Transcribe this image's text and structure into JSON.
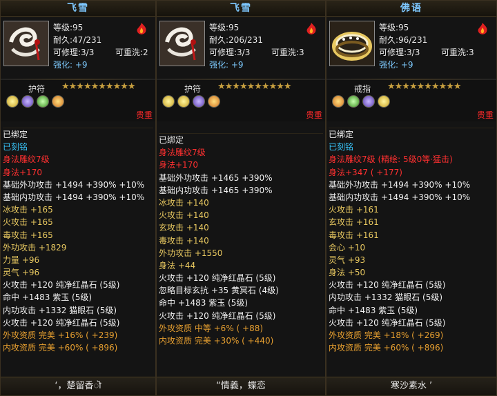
{
  "panels": [
    {
      "title": "飞雪",
      "level": "等级:95",
      "durability": "耐久:47/231",
      "repairable": "可修理:3/3",
      "rewash": "可重洗:2",
      "enhance": "强化: +9",
      "slot_label": "护符",
      "stars": "★★★★★★★★★★",
      "quality": "贵重",
      "footer": "‘，楚留香ॊ",
      "lines": [
        {
          "text": "已绑定",
          "color": "w"
        },
        {
          "text": "已刻铭",
          "color": "b"
        },
        {
          "text": "身法雕纹7级",
          "color": "r"
        },
        {
          "text": "身法+170",
          "color": "r"
        },
        {
          "text": "基础外功攻击 +1494 +390% +10%",
          "color": "w"
        },
        {
          "text": "基础内功攻击 +1494 +390% +10%",
          "color": "w"
        },
        {
          "text": "冰攻击 +165",
          "color": "y"
        },
        {
          "text": "火攻击 +165",
          "color": "y"
        },
        {
          "text": "毒攻击 +165",
          "color": "y"
        },
        {
          "text": "外功攻击 +1829",
          "color": "y"
        },
        {
          "text": "力量 +96",
          "color": "y"
        },
        {
          "text": "灵气 +96",
          "color": "y"
        },
        {
          "text": "火攻击 +120 纯净红晶石 (5级)",
          "color": "w"
        },
        {
          "text": "命中 +1483 紫玉 (5级)",
          "color": "w"
        },
        {
          "text": "内功攻击 +1332 猫眼石 (5级)",
          "color": "w"
        },
        {
          "text": "火攻击 +120 纯净红晶石 (5级)",
          "color": "w"
        },
        {
          "text": "外攻资质  完美 +16% ( +239)",
          "color": "o"
        },
        {
          "text": "内攻资质  完美 +60% ( +896)",
          "color": "o"
        }
      ]
    },
    {
      "title": "飞雪",
      "level": "等级:95",
      "durability": "耐久:206/231",
      "repairable": "可修理:3/3",
      "rewash": "可重洗:3",
      "enhance": "强化: +9",
      "slot_label": "护符",
      "stars": "★★★★★★★★★★",
      "quality": "贵重",
      "footer": "“情義，蝶恋",
      "lines": [
        {
          "text": "已绑定",
          "color": "w"
        },
        {
          "text": "身法雕纹7级",
          "color": "r"
        },
        {
          "text": "身法+170",
          "color": "r"
        },
        {
          "text": "基础外功攻击 +1465 +390%",
          "color": "w"
        },
        {
          "text": "基础内功攻击 +1465 +390%",
          "color": "w"
        },
        {
          "text": "冰攻击 +140",
          "color": "y"
        },
        {
          "text": "火攻击 +140",
          "color": "y"
        },
        {
          "text": "玄攻击 +140",
          "color": "y"
        },
        {
          "text": "毒攻击 +140",
          "color": "y"
        },
        {
          "text": "外功攻击 +1550",
          "color": "y"
        },
        {
          "text": "身法 +44",
          "color": "y"
        },
        {
          "text": "火攻击 +120 纯净红晶石 (5级)",
          "color": "w"
        },
        {
          "text": "忽略目标玄抗 +35 黄冥石 (4级)",
          "color": "w"
        },
        {
          "text": "命中 +1483 紫玉 (5级)",
          "color": "w"
        },
        {
          "text": "火攻击 +120 纯净红晶石 (5级)",
          "color": "w"
        },
        {
          "text": "外攻资质  中等 +6% ( +88)",
          "color": "o"
        },
        {
          "text": "内攻资质  完美 +30% ( +440)",
          "color": "o"
        }
      ]
    },
    {
      "title": "佛语",
      "level": "等级:95",
      "durability": "耐久:96/231",
      "repairable": "可修理:3/3",
      "rewash": "可重洗:3",
      "enhance": "强化: +9",
      "slot_label": "戒指",
      "stars": "★★★★★★★★★★",
      "quality": "贵重",
      "footer": "寒沙素水 ’",
      "lines": [
        {
          "text": "已绑定",
          "color": "w"
        },
        {
          "text": "已刻铭",
          "color": "b"
        },
        {
          "text": "身法雕纹7级 (精绘: 5级0等·猛击)",
          "color": "r"
        },
        {
          "text": "身法+347 ( +177)",
          "color": "r"
        },
        {
          "text": "基础外功攻击 +1494 +390% +10%",
          "color": "w"
        },
        {
          "text": "基础内功攻击 +1494 +390% +10%",
          "color": "w"
        },
        {
          "text": "火攻击 +161",
          "color": "y"
        },
        {
          "text": "玄攻击 +161",
          "color": "y"
        },
        {
          "text": "毒攻击 +161",
          "color": "y"
        },
        {
          "text": "会心 +10",
          "color": "y"
        },
        {
          "text": "灵气 +93",
          "color": "y"
        },
        {
          "text": "身法 +50",
          "color": "y"
        },
        {
          "text": "火攻击 +120 纯净红晶石 (5级)",
          "color": "w"
        },
        {
          "text": "内功攻击 +1332 猫眼石 (5级)",
          "color": "w"
        },
        {
          "text": "命中 +1483 紫玉 (5级)",
          "color": "w"
        },
        {
          "text": "火攻击 +120 纯净红晶石 (5级)",
          "color": "w"
        },
        {
          "text": "外攻资质  完美 +18% ( +269)",
          "color": "o"
        },
        {
          "text": "内攻资质  完美 +60% ( +896)",
          "color": "o"
        }
      ]
    }
  ],
  "gem_colors": [
    "#e8c840",
    "#7a5cd8",
    "#e8c840",
    "#d8a030"
  ]
}
